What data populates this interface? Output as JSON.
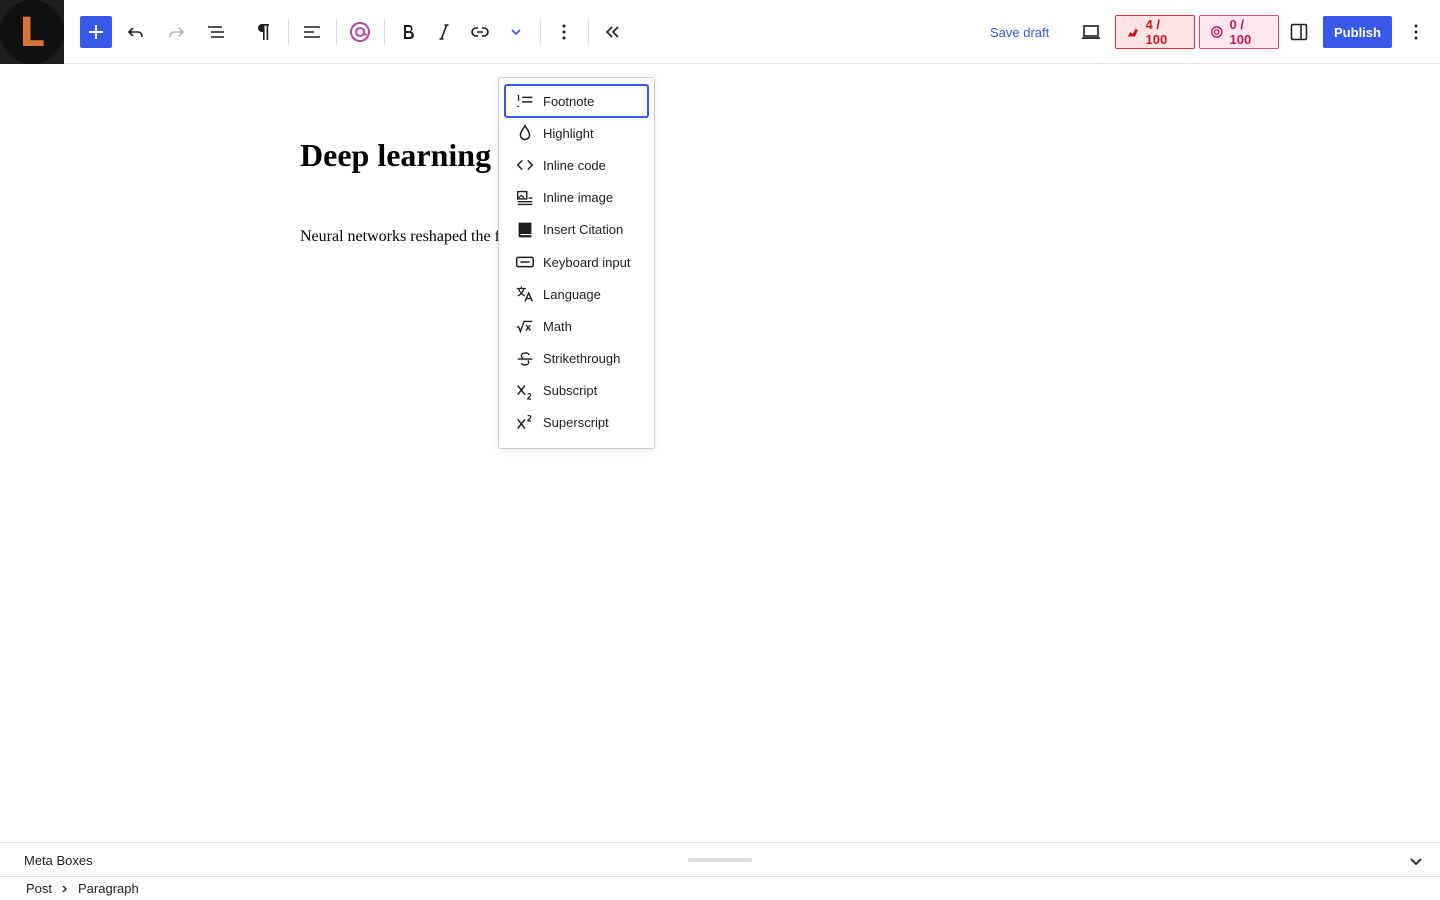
{
  "toolbar": {
    "site_logo_letter": "L",
    "save_draft_label": "Save draft",
    "score_a": {
      "value": "4 / 100",
      "icon": "seo-score-icon",
      "color": "#cc1818"
    },
    "score_b": {
      "value": "0 / 100",
      "icon": "readability-score-icon",
      "color": "#c2185b"
    },
    "publish_label": "Publish",
    "accent_color": "#3858e9"
  },
  "editor": {
    "title": "Deep learning",
    "paragraph": "Neural networks reshaped the f"
  },
  "format_menu": {
    "items": [
      {
        "label": "Footnote",
        "icon": "footnote-icon",
        "focused": true
      },
      {
        "label": "Highlight",
        "icon": "highlight-drop-icon"
      },
      {
        "label": "Inline code",
        "icon": "code-icon"
      },
      {
        "label": "Inline image",
        "icon": "inline-image-icon"
      },
      {
        "label": "Insert Citation",
        "icon": "book-icon"
      },
      {
        "label": "Keyboard input",
        "icon": "keyboard-icon"
      },
      {
        "label": "Language",
        "icon": "language-icon"
      },
      {
        "label": "Math",
        "icon": "math-icon"
      },
      {
        "label": "Strikethrough",
        "icon": "strikethrough-icon"
      },
      {
        "label": "Subscript",
        "icon": "subscript-icon"
      },
      {
        "label": "Superscript",
        "icon": "superscript-icon"
      }
    ]
  },
  "metabar": {
    "label": "Meta Boxes"
  },
  "breadcrumb": [
    "Post",
    "Paragraph"
  ]
}
